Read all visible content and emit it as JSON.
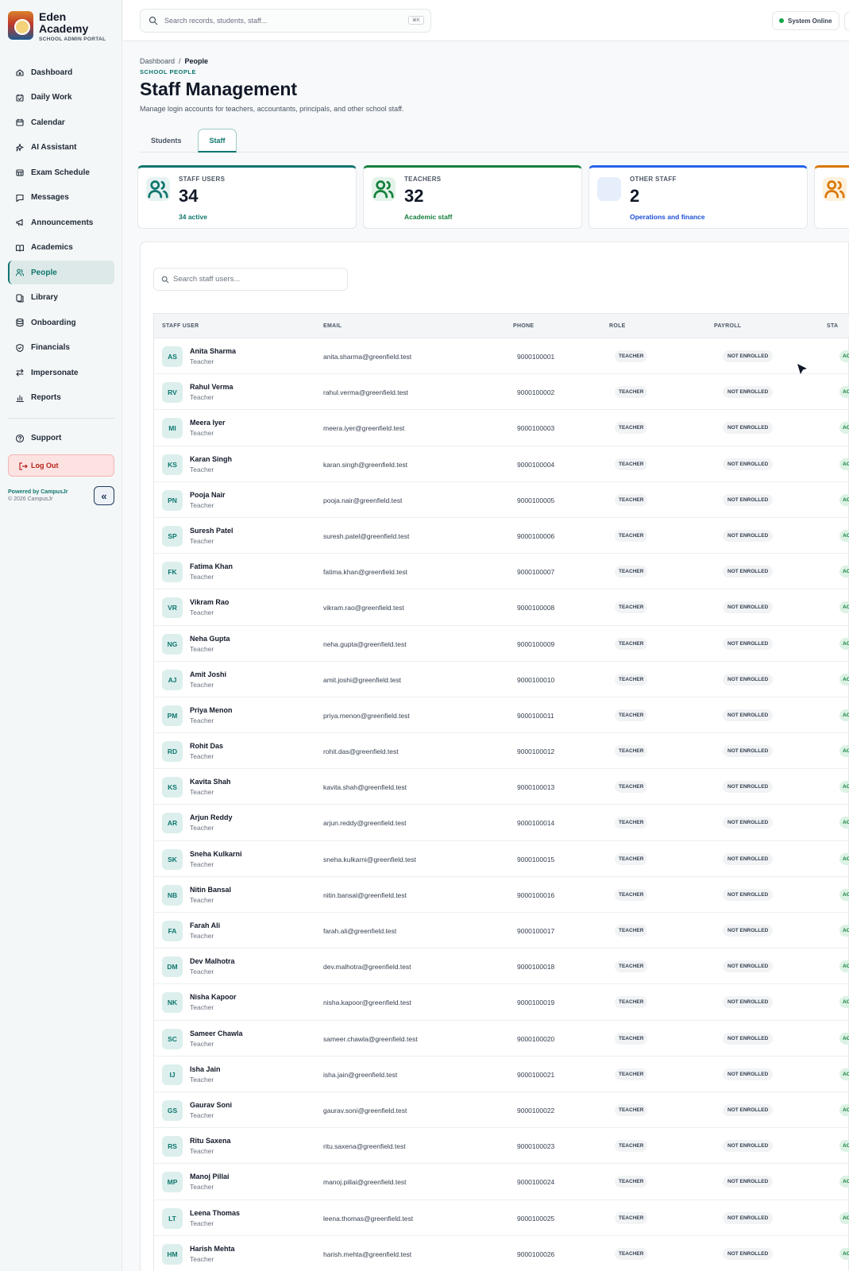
{
  "brand": {
    "name": "Eden Academy",
    "subtitle": "SCHOOL ADMIN PORTAL"
  },
  "sidebar": {
    "items": [
      {
        "label": "Dashboard",
        "icon": "dashboard-icon"
      },
      {
        "label": "Daily Work",
        "icon": "calendar-check-icon"
      },
      {
        "label": "Calendar",
        "icon": "calendar-icon"
      },
      {
        "label": "AI Assistant",
        "icon": "sparkle-icon"
      },
      {
        "label": "Exam Schedule",
        "icon": "calendar-grid-icon"
      },
      {
        "label": "Messages",
        "icon": "message-icon"
      },
      {
        "label": "Announcements",
        "icon": "megaphone-icon"
      },
      {
        "label": "Academics",
        "icon": "book-icon"
      },
      {
        "label": "People",
        "icon": "users-icon",
        "active": true
      },
      {
        "label": "Library",
        "icon": "library-icon"
      },
      {
        "label": "Onboarding",
        "icon": "database-icon"
      },
      {
        "label": "Financials",
        "icon": "shield-icon"
      },
      {
        "label": "Impersonate",
        "icon": "swap-icon"
      },
      {
        "label": "Reports",
        "icon": "bar-chart-icon"
      }
    ],
    "support": "Support",
    "logout": "Log Out",
    "powered_by": "Powered by CampusJr",
    "copyright": "© 2026 CampusJr"
  },
  "topbar": {
    "search_placeholder": "Search records, students, staff...",
    "shortcut": "⌘K",
    "status": "System Online"
  },
  "page": {
    "breadcrumb_root": "Dashboard",
    "breadcrumb_sep": "/",
    "breadcrumb_current": "People",
    "eyebrow": "SCHOOL PEOPLE",
    "title": "Staff Management",
    "description": "Manage login accounts for teachers, accountants, principals, and other school staff.",
    "tabs": [
      "Students",
      "Staff"
    ],
    "active_tab": "Staff"
  },
  "stats": [
    {
      "label": "STAFF USERS",
      "value": "34",
      "sub": "34 active",
      "accent": "#0f766e",
      "sub_color": "#0f766e",
      "icon": "users-icon"
    },
    {
      "label": "TEACHERS",
      "value": "32",
      "sub": "Academic staff",
      "accent": "#15803d",
      "sub_color": "#15803d",
      "icon": "teacher-icon"
    },
    {
      "label": "OTHER STAFF",
      "value": "2",
      "sub": "Operations and finance",
      "accent": "#2563eb",
      "sub_color": "#1d4ed8",
      "icon": "briefcase-icon"
    }
  ],
  "table": {
    "search_placeholder": "Search staff users...",
    "columns": [
      "STAFF USER",
      "EMAIL",
      "PHONE",
      "ROLE",
      "PAYROLL",
      "STA"
    ],
    "status_text": "AC",
    "rows": [
      {
        "initials": "AS",
        "name": "Anita Sharma",
        "role_label": "Teacher",
        "email": "anita.sharma@greenfield.test",
        "phone": "9000100001",
        "role": "TEACHER",
        "payroll": "NOT ENROLLED"
      },
      {
        "initials": "RV",
        "name": "Rahul Verma",
        "role_label": "Teacher",
        "email": "rahul.verma@greenfield.test",
        "phone": "9000100002",
        "role": "TEACHER",
        "payroll": "NOT ENROLLED"
      },
      {
        "initials": "MI",
        "name": "Meera Iyer",
        "role_label": "Teacher",
        "email": "meera.iyer@greenfield.test",
        "phone": "9000100003",
        "role": "TEACHER",
        "payroll": "NOT ENROLLED"
      },
      {
        "initials": "KS",
        "name": "Karan Singh",
        "role_label": "Teacher",
        "email": "karan.singh@greenfield.test",
        "phone": "9000100004",
        "role": "TEACHER",
        "payroll": "NOT ENROLLED"
      },
      {
        "initials": "PN",
        "name": "Pooja Nair",
        "role_label": "Teacher",
        "email": "pooja.nair@greenfield.test",
        "phone": "9000100005",
        "role": "TEACHER",
        "payroll": "NOT ENROLLED"
      },
      {
        "initials": "SP",
        "name": "Suresh Patel",
        "role_label": "Teacher",
        "email": "suresh.patel@greenfield.test",
        "phone": "9000100006",
        "role": "TEACHER",
        "payroll": "NOT ENROLLED"
      },
      {
        "initials": "FK",
        "name": "Fatima Khan",
        "role_label": "Teacher",
        "email": "fatima.khan@greenfield.test",
        "phone": "9000100007",
        "role": "TEACHER",
        "payroll": "NOT ENROLLED"
      },
      {
        "initials": "VR",
        "name": "Vikram Rao",
        "role_label": "Teacher",
        "email": "vikram.rao@greenfield.test",
        "phone": "9000100008",
        "role": "TEACHER",
        "payroll": "NOT ENROLLED"
      },
      {
        "initials": "NG",
        "name": "Neha Gupta",
        "role_label": "Teacher",
        "email": "neha.gupta@greenfield.test",
        "phone": "9000100009",
        "role": "TEACHER",
        "payroll": "NOT ENROLLED"
      },
      {
        "initials": "AJ",
        "name": "Amit Joshi",
        "role_label": "Teacher",
        "email": "amit.joshi@greenfield.test",
        "phone": "9000100010",
        "role": "TEACHER",
        "payroll": "NOT ENROLLED"
      },
      {
        "initials": "PM",
        "name": "Priya Menon",
        "role_label": "Teacher",
        "email": "priya.menon@greenfield.test",
        "phone": "9000100011",
        "role": "TEACHER",
        "payroll": "NOT ENROLLED"
      },
      {
        "initials": "RD",
        "name": "Rohit Das",
        "role_label": "Teacher",
        "email": "rohit.das@greenfield.test",
        "phone": "9000100012",
        "role": "TEACHER",
        "payroll": "NOT ENROLLED"
      },
      {
        "initials": "KS",
        "name": "Kavita Shah",
        "role_label": "Teacher",
        "email": "kavita.shah@greenfield.test",
        "phone": "9000100013",
        "role": "TEACHER",
        "payroll": "NOT ENROLLED"
      },
      {
        "initials": "AR",
        "name": "Arjun Reddy",
        "role_label": "Teacher",
        "email": "arjun.reddy@greenfield.test",
        "phone": "9000100014",
        "role": "TEACHER",
        "payroll": "NOT ENROLLED"
      },
      {
        "initials": "SK",
        "name": "Sneha Kulkarni",
        "role_label": "Teacher",
        "email": "sneha.kulkarni@greenfield.test",
        "phone": "9000100015",
        "role": "TEACHER",
        "payroll": "NOT ENROLLED"
      },
      {
        "initials": "NB",
        "name": "Nitin Bansal",
        "role_label": "Teacher",
        "email": "nitin.bansal@greenfield.test",
        "phone": "9000100016",
        "role": "TEACHER",
        "payroll": "NOT ENROLLED"
      },
      {
        "initials": "FA",
        "name": "Farah Ali",
        "role_label": "Teacher",
        "email": "farah.ali@greenfield.test",
        "phone": "9000100017",
        "role": "TEACHER",
        "payroll": "NOT ENROLLED"
      },
      {
        "initials": "DM",
        "name": "Dev Malhotra",
        "role_label": "Teacher",
        "email": "dev.malhotra@greenfield.test",
        "phone": "9000100018",
        "role": "TEACHER",
        "payroll": "NOT ENROLLED"
      },
      {
        "initials": "NK",
        "name": "Nisha Kapoor",
        "role_label": "Teacher",
        "email": "nisha.kapoor@greenfield.test",
        "phone": "9000100019",
        "role": "TEACHER",
        "payroll": "NOT ENROLLED"
      },
      {
        "initials": "SC",
        "name": "Sameer Chawla",
        "role_label": "Teacher",
        "email": "sameer.chawla@greenfield.test",
        "phone": "9000100020",
        "role": "TEACHER",
        "payroll": "NOT ENROLLED"
      },
      {
        "initials": "IJ",
        "name": "Isha Jain",
        "role_label": "Teacher",
        "email": "isha.jain@greenfield.test",
        "phone": "9000100021",
        "role": "TEACHER",
        "payroll": "NOT ENROLLED"
      },
      {
        "initials": "GS",
        "name": "Gaurav Soni",
        "role_label": "Teacher",
        "email": "gaurav.soni@greenfield.test",
        "phone": "9000100022",
        "role": "TEACHER",
        "payroll": "NOT ENROLLED"
      },
      {
        "initials": "RS",
        "name": "Ritu Saxena",
        "role_label": "Teacher",
        "email": "ritu.saxena@greenfield.test",
        "phone": "9000100023",
        "role": "TEACHER",
        "payroll": "NOT ENROLLED"
      },
      {
        "initials": "MP",
        "name": "Manoj Pillai",
        "role_label": "Teacher",
        "email": "manoj.pillai@greenfield.test",
        "phone": "9000100024",
        "role": "TEACHER",
        "payroll": "NOT ENROLLED"
      },
      {
        "initials": "LT",
        "name": "Leena Thomas",
        "role_label": "Teacher",
        "email": "leena.thomas@greenfield.test",
        "phone": "9000100025",
        "role": "TEACHER",
        "payroll": "NOT ENROLLED"
      },
      {
        "initials": "HM",
        "name": "Harish Mehta",
        "role_label": "Teacher",
        "email": "harish.mehta@greenfield.test",
        "phone": "9000100026",
        "role": "TEACHER",
        "payroll": "NOT ENROLLED"
      }
    ]
  }
}
